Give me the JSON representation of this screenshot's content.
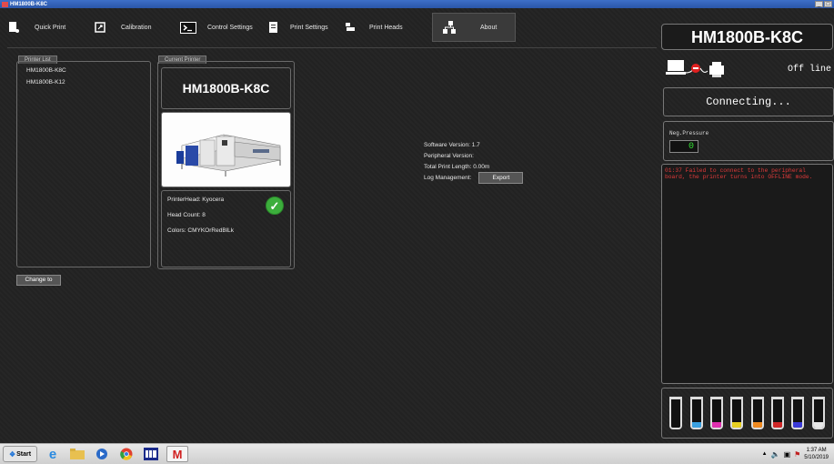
{
  "window": {
    "title": "HM1800B-K8C"
  },
  "toolbar": {
    "items": [
      {
        "label": "Quick Print",
        "icon": "quick-print-icon"
      },
      {
        "label": "Calibration",
        "icon": "calibration-icon"
      },
      {
        "label": "Control Settings",
        "icon": "terminal-icon"
      },
      {
        "label": "Print Settings",
        "icon": "print-settings-icon"
      },
      {
        "label": "Print Heads",
        "icon": "print-heads-icon"
      },
      {
        "label": "About",
        "icon": "network-icon"
      }
    ]
  },
  "printer_list": {
    "tab": "Printer List",
    "items": [
      "HM1800B-K8C",
      "HM1800B-K12"
    ],
    "change_button": "Change to"
  },
  "current_printer": {
    "tab": "Current Printer",
    "name": "HM1800B-K8C",
    "printhead": "PrinterHead: Kyocera",
    "head_count": "Head Count: 8",
    "colors": "Colors: CMYKOrRedBlLk"
  },
  "about": {
    "software_version": "Software Version:  1.7",
    "peripheral_version": "Peripheral Version:",
    "total_print_length": "Total Print Length:  0.00m",
    "log_management": "Log Management:",
    "export_button": "Export"
  },
  "right_panel": {
    "model": "HM1800B-K8C",
    "status": "Off line",
    "connection": "Connecting...",
    "pressure_label": "Neg.Pressure",
    "pressure_value": "0",
    "log": "01:37 Failed to connect to the peripheral board, the printer turns into OFFLINE mode.",
    "ink_colors": [
      "#3aa0e0",
      "#e030b0",
      "#e8d020",
      "#f08a20",
      "#d02828",
      "#3a3ad8",
      "#e8e8e8"
    ]
  },
  "taskbar": {
    "start": "Start",
    "time": "1:37 AM",
    "date": "5/10/2019"
  }
}
